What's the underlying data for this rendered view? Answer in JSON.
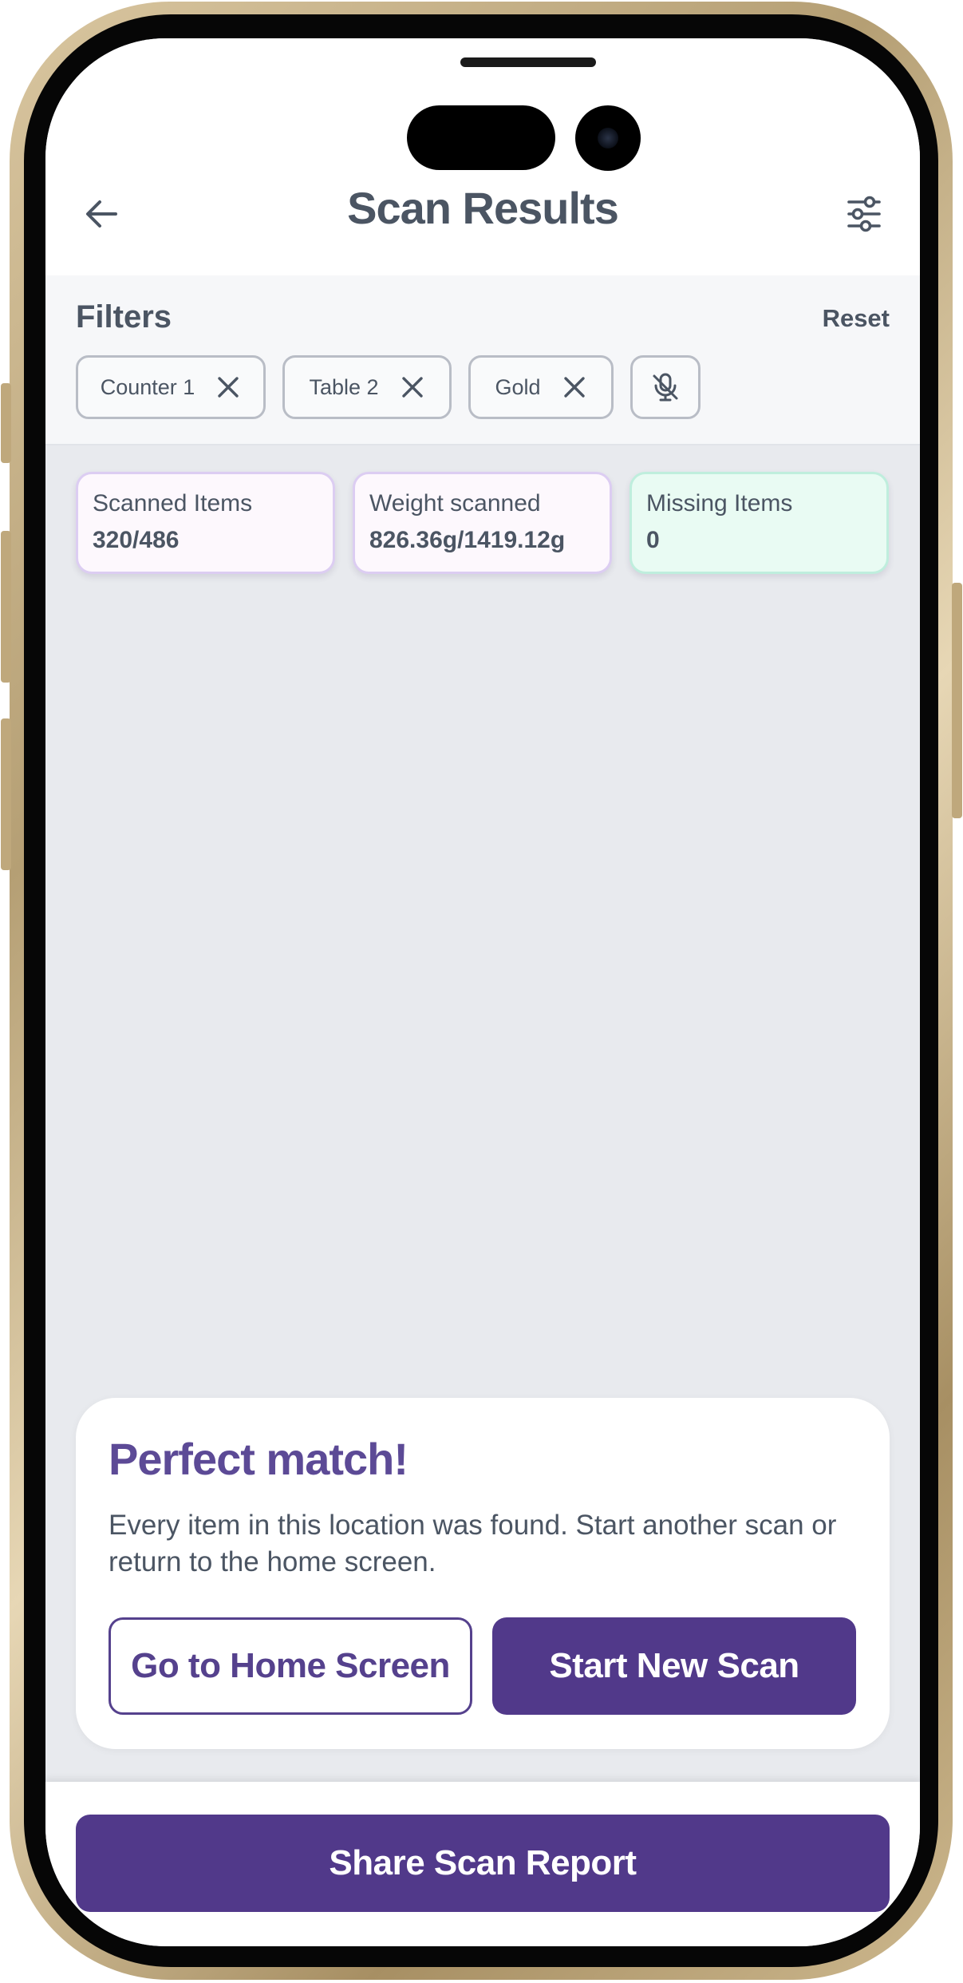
{
  "header": {
    "title": "Scan Results",
    "back_icon": "arrow-left-icon",
    "filter_icon": "sliders-icon"
  },
  "filters": {
    "title": "Filters",
    "reset_label": "Reset",
    "chips": [
      {
        "label": "Counter 1"
      },
      {
        "label": "Table 2"
      },
      {
        "label": "Gold"
      }
    ],
    "extra_chip_icon": "mic-off-icon"
  },
  "stats": [
    {
      "label": "Scanned Items",
      "value": "320/486"
    },
    {
      "label": "Weight scanned",
      "value": "826.36g/1419.12g"
    },
    {
      "label": "Missing Items",
      "value": "0"
    }
  ],
  "result": {
    "title": "Perfect match!",
    "message": "Every item in this location was found. Start another scan or return to the home screen.",
    "home_button": "Go to Home Screen",
    "new_scan_button": "Start New Scan"
  },
  "footer": {
    "share_button": "Share Scan Report"
  },
  "colors": {
    "primary": "#51398a",
    "title_accent": "#5c4a96",
    "text": "#4b5563",
    "success_bg": "#e9fbf3"
  }
}
